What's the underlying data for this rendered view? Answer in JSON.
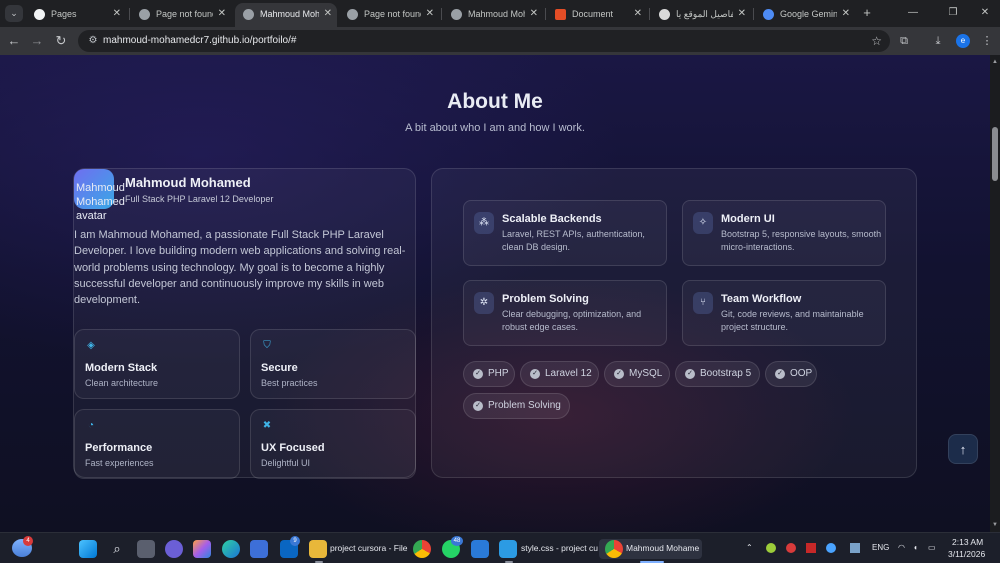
{
  "browser": {
    "tabs": [
      {
        "title": "Pages",
        "color": "#ffffff"
      },
      {
        "title": "Page not found",
        "color": "#9aa0a6"
      },
      {
        "title": "Mahmoud Moha",
        "color": "#9aa0a6",
        "active": true
      },
      {
        "title": "Page not found",
        "color": "#9aa0a6"
      },
      {
        "title": "Mahmoud Moha",
        "color": "#9aa0a6"
      },
      {
        "title": "Document",
        "color": "#e44d26"
      },
      {
        "title": "تفاصيل الموقع يا",
        "color": "#d9d9d9"
      },
      {
        "title": "Google Gemini",
        "color": "#4e8cf5"
      }
    ],
    "url": "mahmoud-mohamedcr7.github.io/portfoilo/#",
    "profile_initial": "e"
  },
  "about": {
    "title": "About Me",
    "subtitle": "A bit about who I am and how I work.",
    "profile": {
      "avatar_alt": "Mahmoud Mohamed avatar",
      "name": "Mahmoud Mohamed",
      "role": "Full Stack PHP Laravel 12 Developer"
    },
    "bio": "I am Mahmoud Mohamed, a passionate Full Stack PHP Laravel Developer. I love building modern web applications and solving real-world problems using technology. My goal is to become a highly successful developer and continuously improve my skills in web development.",
    "mini_cards": [
      {
        "icon": "layers-icon",
        "title": "Modern Stack",
        "sub": "Clean architecture"
      },
      {
        "icon": "shield-icon",
        "title": "Secure",
        "sub": "Best practices"
      },
      {
        "icon": "gauge-icon",
        "title": "Performance",
        "sub": "Fast experiences"
      },
      {
        "icon": "tools-icon",
        "title": "UX Focused",
        "sub": "Delightful UI"
      }
    ],
    "features": [
      {
        "icon": "server-icon",
        "title": "Scalable Backends",
        "desc": "Laravel, REST APIs, authentication, clean DB design."
      },
      {
        "icon": "magic-wand-icon",
        "title": "Modern UI",
        "desc": "Bootstrap 5, responsive layouts, smooth micro-interactions."
      },
      {
        "icon": "bug-icon",
        "title": "Problem Solving",
        "desc": "Clear debugging, optimization, and robust edge cases."
      },
      {
        "icon": "git-branch-icon",
        "title": "Team Workflow",
        "desc": "Git, code reviews, and maintainable project structure."
      }
    ],
    "skills": [
      "PHP",
      "Laravel 12",
      "MySQL",
      "Bootstrap 5",
      "OOP",
      "Problem Solving"
    ]
  },
  "taskbar": {
    "weather_badge": "4",
    "apps": [
      {
        "name": "project cursora - File",
        "icon": "folder-icon"
      },
      {
        "name": "style.css - project cu",
        "icon": "vscode-icon"
      },
      {
        "name": "Mahmoud Mohame",
        "icon": "chrome-icon"
      }
    ],
    "badges": {
      "linkedin": "9",
      "whatsapp": "48"
    },
    "language": "ENG",
    "time": "2:13 AM",
    "date": "3/11/2026"
  }
}
